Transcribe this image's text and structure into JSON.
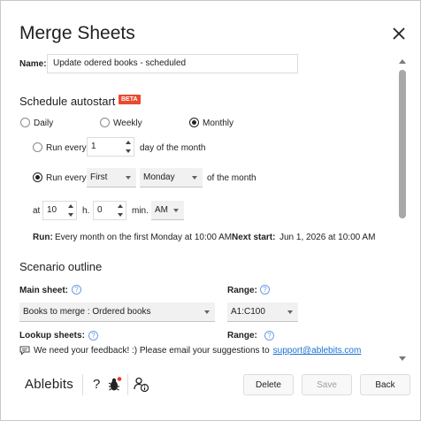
{
  "window": {
    "title": "Merge Sheets"
  },
  "name": {
    "label": "Name:",
    "value": "Update odered books - scheduled"
  },
  "schedule": {
    "heading": "Schedule autostart",
    "badge": "BETA",
    "freq": {
      "daily": "Daily",
      "weekly": "Weekly",
      "monthly": "Monthly",
      "selected": "Monthly"
    },
    "run_every_day": {
      "label": "Run every",
      "value": "1",
      "suffix": "day of the month"
    },
    "run_every_week": {
      "label": "Run every",
      "ordinal": "First",
      "weekday": "Monday",
      "suffix": "of the month"
    },
    "time": {
      "at_label": "at",
      "hour": "10",
      "h_label": "h.",
      "minute": "0",
      "min_label": "min.",
      "ampm": "AM"
    },
    "summary": {
      "run_label": "Run:",
      "run_text": "Every month on the first Monday at 10:00 AM.",
      "next_label": "Next start:",
      "next_text": "Jun 1, 2026 at 10:00 AM"
    }
  },
  "outline": {
    "heading": "Scenario outline",
    "main_sheet_label": "Main sheet:",
    "main_sheet_value": "Books to merge : Ordered books",
    "range_label": "Range:",
    "range_value": "A1:C100",
    "help_glyph": "?",
    "lookup_label": "Lookup sheets:",
    "lookup_range_label": "Range:"
  },
  "feedback": {
    "text": "We need your feedback! :) Please email your suggestions to",
    "link": "support@ablebits.com"
  },
  "footer": {
    "brand": "Ablebits",
    "help_glyph": "?",
    "buttons": {
      "delete": "Delete",
      "save": "Save",
      "back": "Back"
    }
  }
}
